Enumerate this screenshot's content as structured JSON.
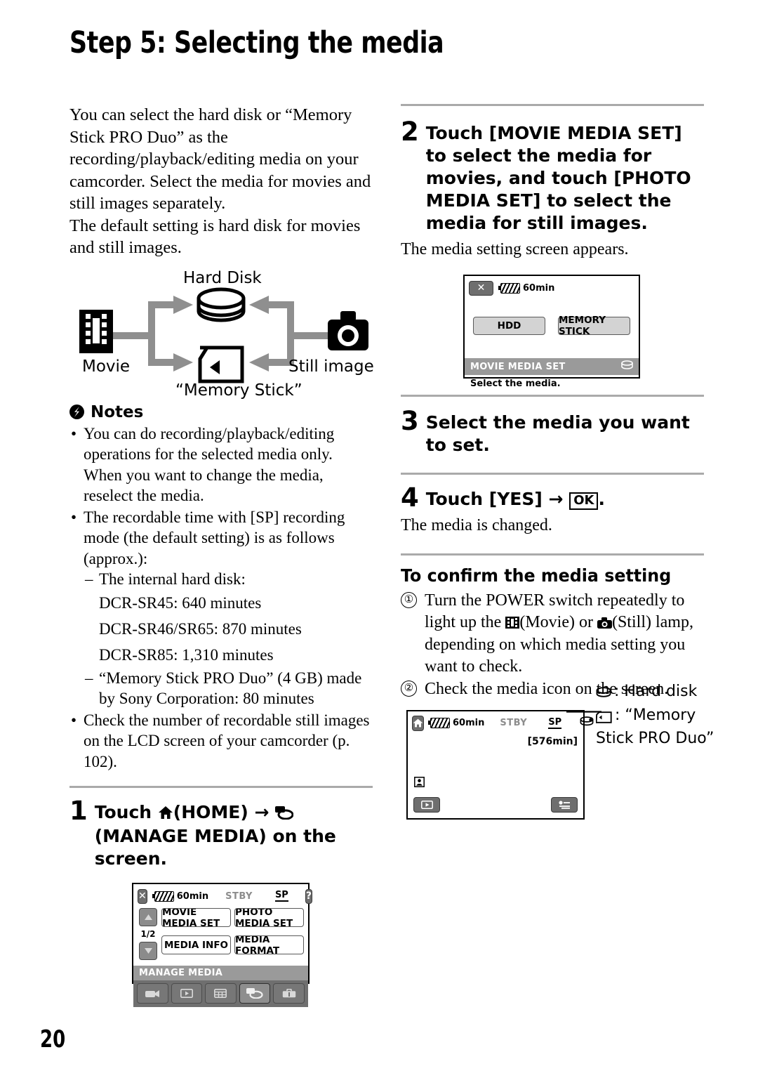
{
  "page": {
    "title": "Step 5: Selecting the media",
    "number": "20"
  },
  "left_column": {
    "intro_paragraph_1": "You can select the hard disk or “Memory Stick PRO Duo” as the recording/playback/editing media on your camcorder. Select the media for movies and still images separately.",
    "intro_paragraph_2": "The default setting is hard disk for movies and still images.",
    "diagram": {
      "hard_disk_label": "Hard Disk",
      "movie_label": "Movie",
      "still_image_label": "Still image",
      "memory_stick_label": "“Memory Stick”"
    },
    "notes": {
      "heading": "Notes",
      "items": [
        "You can do recording/playback/editing operations for the selected media only. When you want to change the media, reselect the media.",
        "The recordable time with [SP] recording mode (the default setting) is as follows (approx.):",
        "Check the number of recordable still images on the LCD screen of your camcorder (p. 102)."
      ],
      "sub_items": {
        "internal_hard_disk": "The internal hard disk:",
        "sr45": "DCR-SR45: 640 minutes",
        "sr46_sr65": "DCR-SR46/SR65: 870 minutes",
        "sr85": "DCR-SR85: 1,310 minutes",
        "memory_stick": "“Memory Stick PRO Duo” (4 GB) made by Sony Corporation: 80 minutes"
      }
    },
    "step1": {
      "number": "1",
      "text_before_home": "Touch",
      "home_label": "(HOME)",
      "arrow": "→",
      "manage_label": "(MANAGE MEDIA) on the screen."
    },
    "lcd_home": {
      "close_label": "✕",
      "battery": "60min",
      "status": "STBY",
      "mode": "SP",
      "help_label": "?",
      "page_indicator": "1/2",
      "buttons": [
        "MOVIE MEDIA SET",
        "PHOTO MEDIA SET",
        "MEDIA INFO",
        "MEDIA FORMAT"
      ],
      "category_label": "MANAGE MEDIA",
      "tabs": [
        "camcorder-tab",
        "playback-tab",
        "index-tab",
        "manage-media-tab",
        "settings-tab"
      ],
      "selected_tab_index": 3
    }
  },
  "right_column": {
    "step2": {
      "number": "2",
      "text": "Touch [MOVIE MEDIA SET] to select the media for movies, and touch [PHOTO MEDIA SET] to select the media for still images.",
      "caption": "The media setting screen appears."
    },
    "lcd_media_set": {
      "close_label": "✕",
      "battery": "60min",
      "option_hdd": "HDD",
      "option_memory_stick": "MEMORY STICK",
      "title_bar": "MOVIE MEDIA SET",
      "instruction": "Select the media."
    },
    "step3": {
      "number": "3",
      "text": "Select the media you want to set."
    },
    "step4": {
      "number": "4",
      "text_before": "Touch [YES]",
      "arrow": "→",
      "ok_label": "OK",
      "period": ".",
      "caption": "The media is changed."
    },
    "confirm": {
      "heading": "To confirm the media setting",
      "item1_part1": "Turn the POWER switch repeatedly to light up the",
      "item1_movie": "(Movie) or",
      "item1_still": "(Still) lamp, depending on which media setting you want to check.",
      "item2": "Check the media icon on the screen.",
      "marker1": "①",
      "marker2": "②"
    },
    "lcd_record": {
      "home_label": "home-icon",
      "battery": "60min",
      "status": "STBY",
      "mode": "SP",
      "remaining": "[576min]",
      "face_icon": "face-detection-icon",
      "playback_label": "playback-icon",
      "options_label": "options-icon"
    },
    "legend": {
      "hard_disk": ": Hard disk",
      "memory_stick_line1": ": “Memory",
      "memory_stick_line2": "Stick PRO Duo”"
    }
  },
  "colors": {
    "rule": "#aaaaaa",
    "lcd_grey_bar": "#9a9a9a",
    "lcd_tab_bar": "#6f6f6f",
    "button_dark": "#6e6e6e",
    "arrow_grey": "#8f8f8f"
  }
}
